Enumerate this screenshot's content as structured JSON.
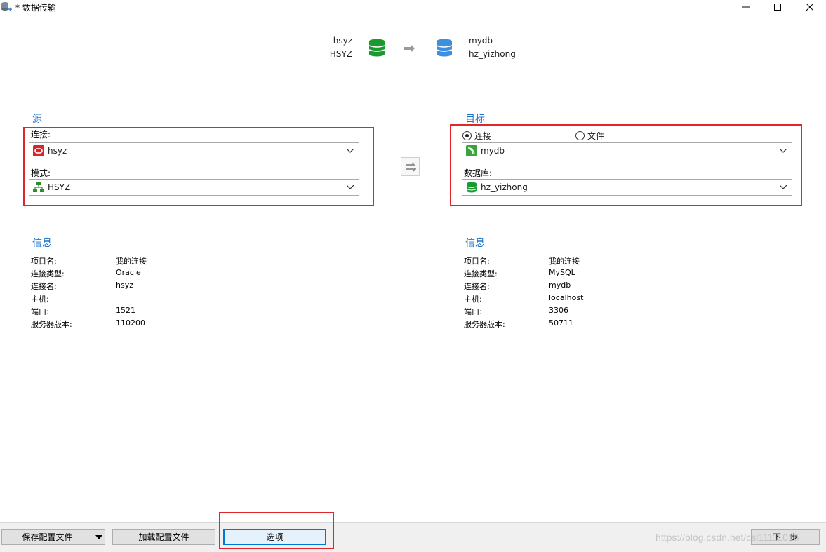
{
  "window": {
    "title": "* 数据传输",
    "controls": {
      "minimize": "minimize-icon",
      "maximize": "maximize-icon",
      "close": "close-icon"
    }
  },
  "header": {
    "source_connection": "hsyz",
    "source_schema": "HSYZ",
    "target_connection": "mydb",
    "target_database": "hz_yizhong",
    "icons": {
      "source_db": "green-database-icon",
      "arrow": "right-arrow-icon",
      "target_db": "blue-database-icon"
    }
  },
  "source": {
    "title": "源",
    "connection_label": "连接:",
    "connection_value": "hsyz",
    "schema_label": "模式:",
    "schema_value": "HSYZ"
  },
  "target": {
    "title": "目标",
    "radio_connection": "连接",
    "radio_file": "文件",
    "selected_radio": "连接",
    "connection_value": "mydb",
    "database_label": "数据库:",
    "database_value": "hz_yizhong"
  },
  "source_info": {
    "title": "信息",
    "rows": [
      {
        "key": "项目名:",
        "value": "我的连接"
      },
      {
        "key": "连接类型:",
        "value": "Oracle"
      },
      {
        "key": "连接名:",
        "value": "hsyz"
      },
      {
        "key": "主机:",
        "value": ""
      },
      {
        "key": "端口:",
        "value": "1521"
      },
      {
        "key": "服务器版本:",
        "value": "110200"
      }
    ]
  },
  "target_info": {
    "title": "信息",
    "rows": [
      {
        "key": "项目名:",
        "value": "我的连接"
      },
      {
        "key": "连接类型:",
        "value": "MySQL"
      },
      {
        "key": "连接名:",
        "value": "mydb"
      },
      {
        "key": "主机:",
        "value": "localhost"
      },
      {
        "key": "端口:",
        "value": "3306"
      },
      {
        "key": "服务器版本:",
        "value": "50711"
      }
    ]
  },
  "footer": {
    "save_profile": "保存配置文件",
    "load_profile": "加载配置文件",
    "options": "选项",
    "next": "下一步"
  },
  "watermark": "https://blog.csdn.net/csl11111015",
  "colors": {
    "accent": "#1a73c8",
    "highlight_border": "#e0252b",
    "oracle_red": "#d9262b",
    "mysql_green": "#3aa33a",
    "db_green": "#1a9a2e",
    "db_blue": "#3d8fe0"
  }
}
